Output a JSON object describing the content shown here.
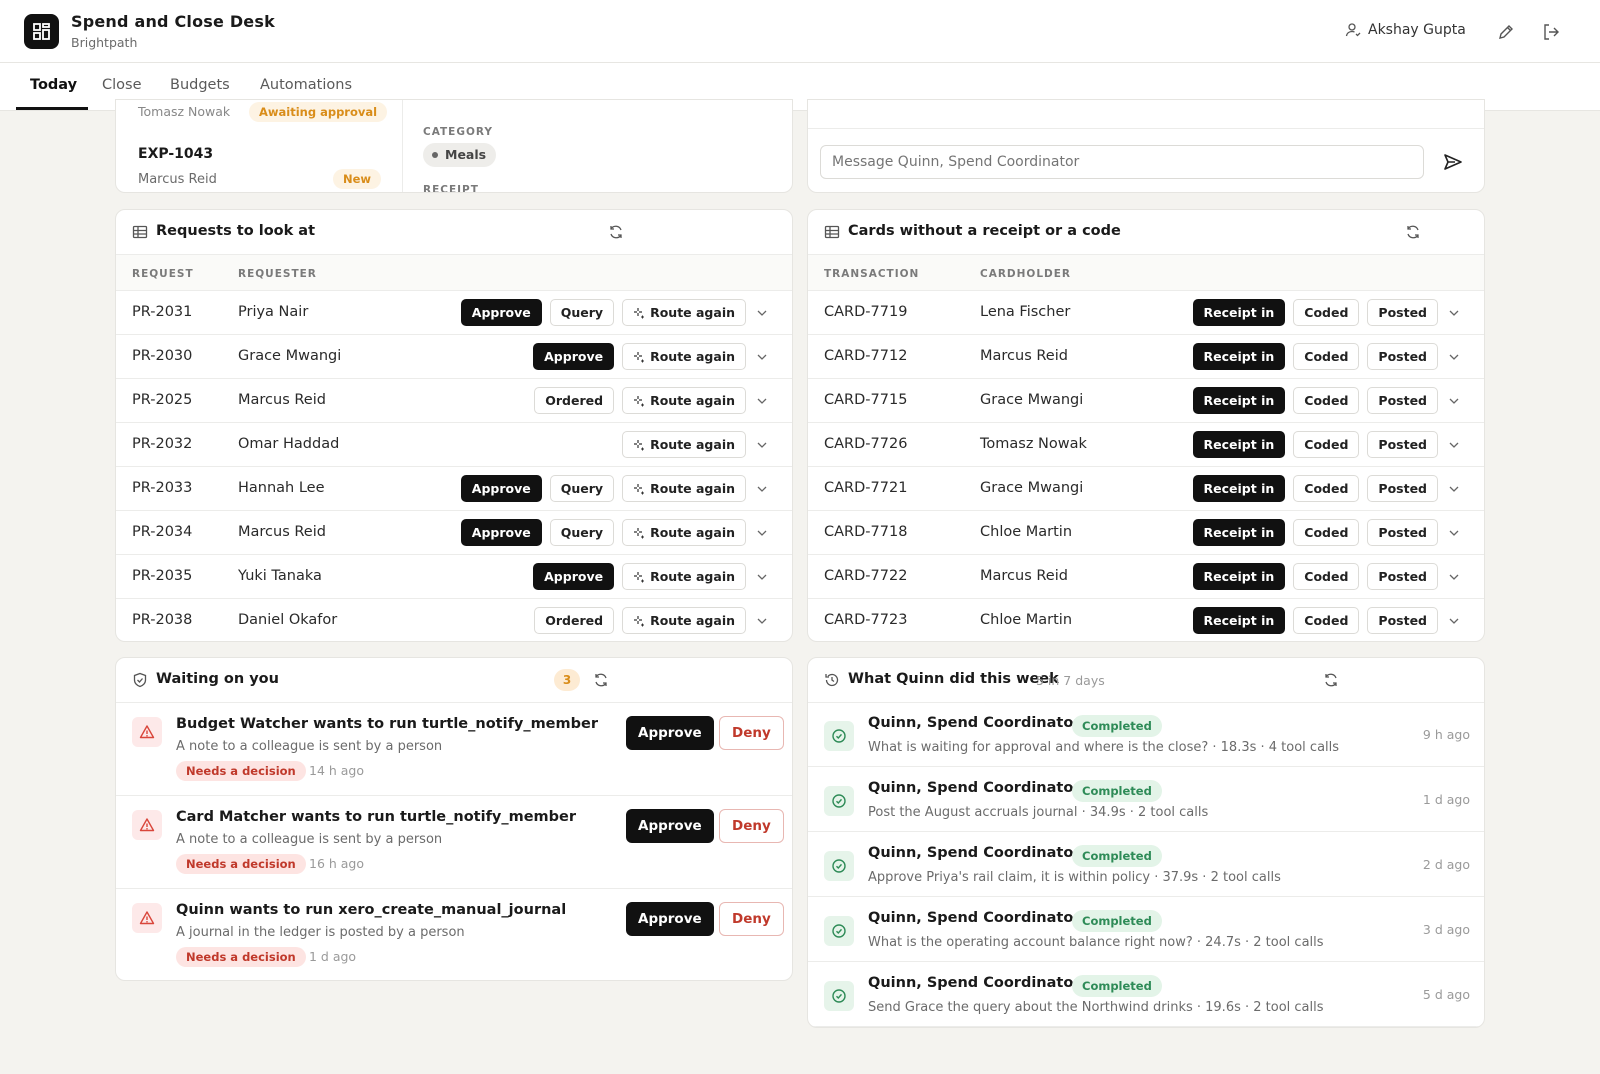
{
  "header": {
    "title": "Spend and Close Desk",
    "org": "Brightpath",
    "user": "Akshay Gupta"
  },
  "tabs": [
    "Today",
    "Close",
    "Budgets",
    "Automations"
  ],
  "expense_panel": {
    "partial_name": "Tomasz Nowak",
    "partial_status": "Awaiting approval",
    "item_id": "EXP-1043",
    "item_person": "Marcus Reid",
    "item_badge": "New",
    "category_label": "CATEGORY",
    "category_value": "Meals",
    "receipt_label": "RECEIPT"
  },
  "chat": {
    "placeholder": "Message Quinn, Spend Coordinator"
  },
  "requests": {
    "title": "Requests to look at",
    "col_request": "REQUEST",
    "col_requester": "REQUESTER",
    "rows": [
      {
        "id": "PR-2031",
        "name": "Priya Nair",
        "actions": [
          "Approve",
          "Query",
          "Route again"
        ]
      },
      {
        "id": "PR-2030",
        "name": "Grace Mwangi",
        "actions": [
          "Approve",
          "Route again"
        ]
      },
      {
        "id": "PR-2025",
        "name": "Marcus Reid",
        "actions": [
          "Ordered",
          "Route again"
        ]
      },
      {
        "id": "PR-2032",
        "name": "Omar Haddad",
        "actions": [
          "Route again"
        ]
      },
      {
        "id": "PR-2033",
        "name": "Hannah Lee",
        "actions": [
          "Approve",
          "Query",
          "Route again"
        ]
      },
      {
        "id": "PR-2034",
        "name": "Marcus Reid",
        "actions": [
          "Approve",
          "Query",
          "Route again"
        ]
      },
      {
        "id": "PR-2035",
        "name": "Yuki Tanaka",
        "actions": [
          "Approve",
          "Route again"
        ]
      },
      {
        "id": "PR-2038",
        "name": "Daniel Okafor",
        "actions": [
          "Ordered",
          "Route again"
        ]
      }
    ]
  },
  "cards": {
    "title": "Cards without a receipt or a code",
    "col_transaction": "TRANSACTION",
    "col_cardholder": "CARDHOLDER",
    "rows": [
      {
        "id": "CARD-7719",
        "name": "Lena Fischer",
        "actions": [
          "Receipt in",
          "Coded",
          "Posted"
        ]
      },
      {
        "id": "CARD-7712",
        "name": "Marcus Reid",
        "actions": [
          "Receipt in",
          "Coded",
          "Posted"
        ]
      },
      {
        "id": "CARD-7715",
        "name": "Grace Mwangi",
        "actions": [
          "Receipt in",
          "Coded",
          "Posted"
        ]
      },
      {
        "id": "CARD-7726",
        "name": "Tomasz Nowak",
        "actions": [
          "Receipt in",
          "Coded",
          "Posted"
        ]
      },
      {
        "id": "CARD-7721",
        "name": "Grace Mwangi",
        "actions": [
          "Receipt in",
          "Coded",
          "Posted"
        ]
      },
      {
        "id": "CARD-7718",
        "name": "Chloe Martin",
        "actions": [
          "Receipt in",
          "Coded",
          "Posted"
        ]
      },
      {
        "id": "CARD-7722",
        "name": "Marcus Reid",
        "actions": [
          "Receipt in",
          "Coded",
          "Posted"
        ]
      },
      {
        "id": "CARD-7723",
        "name": "Chloe Martin",
        "actions": [
          "Receipt in",
          "Coded",
          "Posted"
        ]
      }
    ]
  },
  "waiting": {
    "title": "Waiting on you",
    "count": "3",
    "approve_label": "Approve",
    "deny_label": "Deny",
    "items": [
      {
        "title": "Budget Watcher wants to run turtle_notify_member",
        "subtitle": "A note to a colleague is sent by a person",
        "badge": "Needs a decision",
        "time": "14 h ago"
      },
      {
        "title": "Card Matcher wants to run turtle_notify_member",
        "subtitle": "A note to a colleague is sent by a person",
        "badge": "Needs a decision",
        "time": "16 h ago"
      },
      {
        "title": "Quinn wants to run xero_create_manual_journal",
        "subtitle": "A journal in the ledger is posted by a person",
        "badge": "Needs a decision",
        "time": "1 d ago"
      }
    ]
  },
  "activity": {
    "title": "What Quinn did this week",
    "meta": "5 in 7 days",
    "items": [
      {
        "agent": "Quinn, Spend Coordinator",
        "status": "Completed",
        "detail": "What is waiting for approval and where is the close? · 18.3s · 4 tool calls",
        "time": "9 h ago"
      },
      {
        "agent": "Quinn, Spend Coordinator",
        "status": "Completed",
        "detail": "Post the August accruals journal · 34.9s · 2 tool calls",
        "time": "1 d ago"
      },
      {
        "agent": "Quinn, Spend Coordinator",
        "status": "Completed",
        "detail": "Approve Priya's rail claim, it is within policy · 37.9s · 2 tool calls",
        "time": "2 d ago"
      },
      {
        "agent": "Quinn, Spend Coordinator",
        "status": "Completed",
        "detail": "What is the operating account balance right now? · 24.7s · 2 tool calls",
        "time": "3 d ago"
      },
      {
        "agent": "Quinn, Spend Coordinator",
        "status": "Completed",
        "detail": "Send Grace the query about the Northwind drinks · 19.6s · 2 tool calls",
        "time": "5 d ago"
      }
    ]
  }
}
